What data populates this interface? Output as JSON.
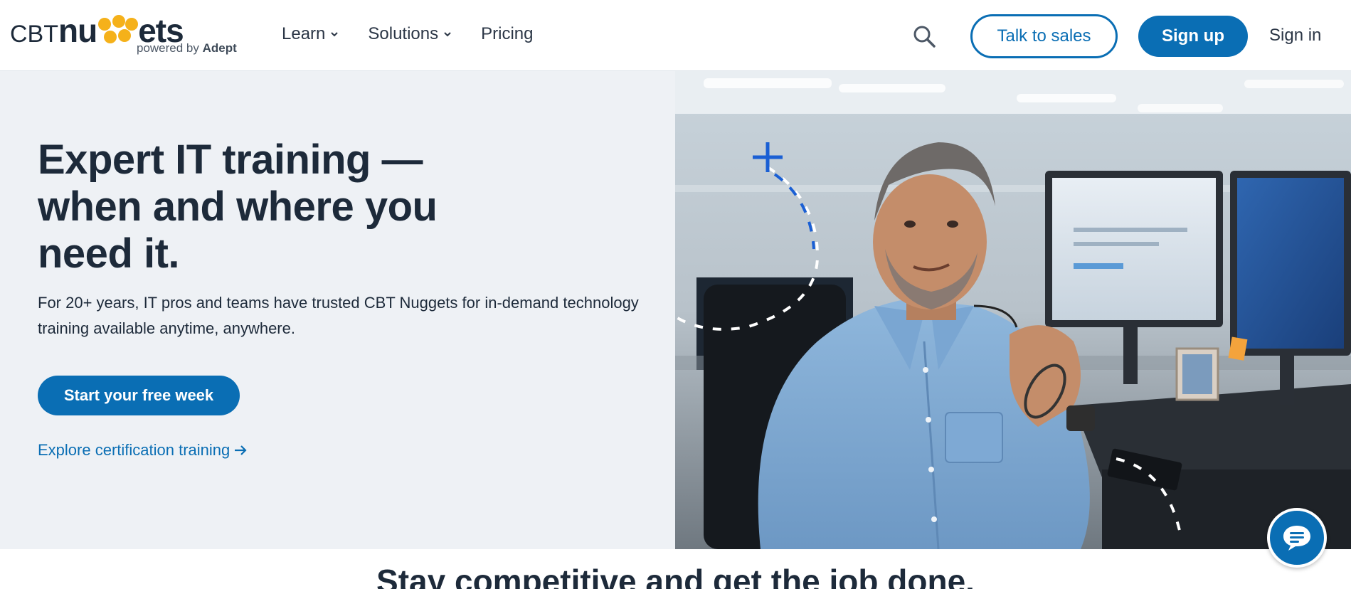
{
  "logo": {
    "text_cbt": "CBT",
    "text_nu": "nu",
    "text_ets": "ets",
    "powered_prefix": "powered by ",
    "powered_brand": "Adept",
    "dot_color": "#f5b11a"
  },
  "nav": {
    "items": [
      {
        "label": "Learn",
        "has_dropdown": true,
        "icon": "chevron-down-icon"
      },
      {
        "label": "Solutions",
        "has_dropdown": true,
        "icon": "chevron-down-icon"
      },
      {
        "label": "Pricing",
        "has_dropdown": false
      }
    ]
  },
  "header": {
    "search_icon": "search-icon",
    "talk_to_sales": "Talk to sales",
    "sign_up": "Sign up",
    "sign_in": "Sign in"
  },
  "hero": {
    "title": "Expert IT training — when and where you need it.",
    "subtitle": "For 20+ years, IT pros and teams have trusted CBT Nuggets for in-demand technology training available anytime, anywhere.",
    "cta": "Start your free week",
    "explore_link": "Explore certification training",
    "explore_icon": "arrow-right-icon",
    "image_subject": "man-with-glasses-at-office-desk"
  },
  "section": {
    "heading": "Stay competitive and get the job done."
  },
  "chat": {
    "icon": "chat-bubble-icon"
  },
  "colors": {
    "brand_blue": "#0a6eb4",
    "text_dark": "#1d2a3a",
    "hero_bg": "#eef1f5",
    "accent_yellow": "#f5b11a"
  }
}
